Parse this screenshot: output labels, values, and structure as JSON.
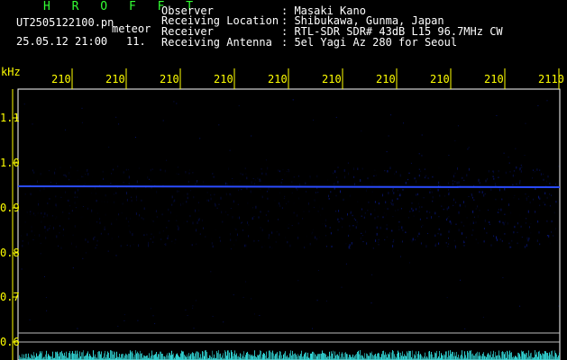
{
  "header": {
    "logo": "H R O F F T",
    "filename": "UT2505122100.pn",
    "meteor_label": "meteor",
    "datetime": "25.05.12 21:00",
    "count": "11.",
    "fields": [
      {
        "label": "Observer",
        "value": ": Masaki Kano"
      },
      {
        "label": "Receiving Location",
        "value": ": Shibukawa, Gunma, Japan"
      },
      {
        "label": "Receiver",
        "value": ": RTL-SDR SDR# 43dB L15 96.7MHz CW"
      },
      {
        "label": "Receiving Antenna",
        "value": ": 5el Yagi Az 280 for Seoul"
      }
    ]
  },
  "axes": {
    "y_unit": "kHz",
    "time_ticks": [
      "210",
      "210",
      "210",
      "210",
      "210",
      "210",
      "210",
      "210",
      "210",
      "2110"
    ],
    "freq_ticks": [
      "1.1",
      "1.0",
      "0.9",
      "0.8",
      "0.7",
      "0.6"
    ]
  },
  "colors": {
    "axis": "#ffff00",
    "frame": "#ffffff",
    "carrier": "#1a3cff",
    "noise": "#0a1a8c",
    "meteor_strip": "#33dddd"
  }
}
